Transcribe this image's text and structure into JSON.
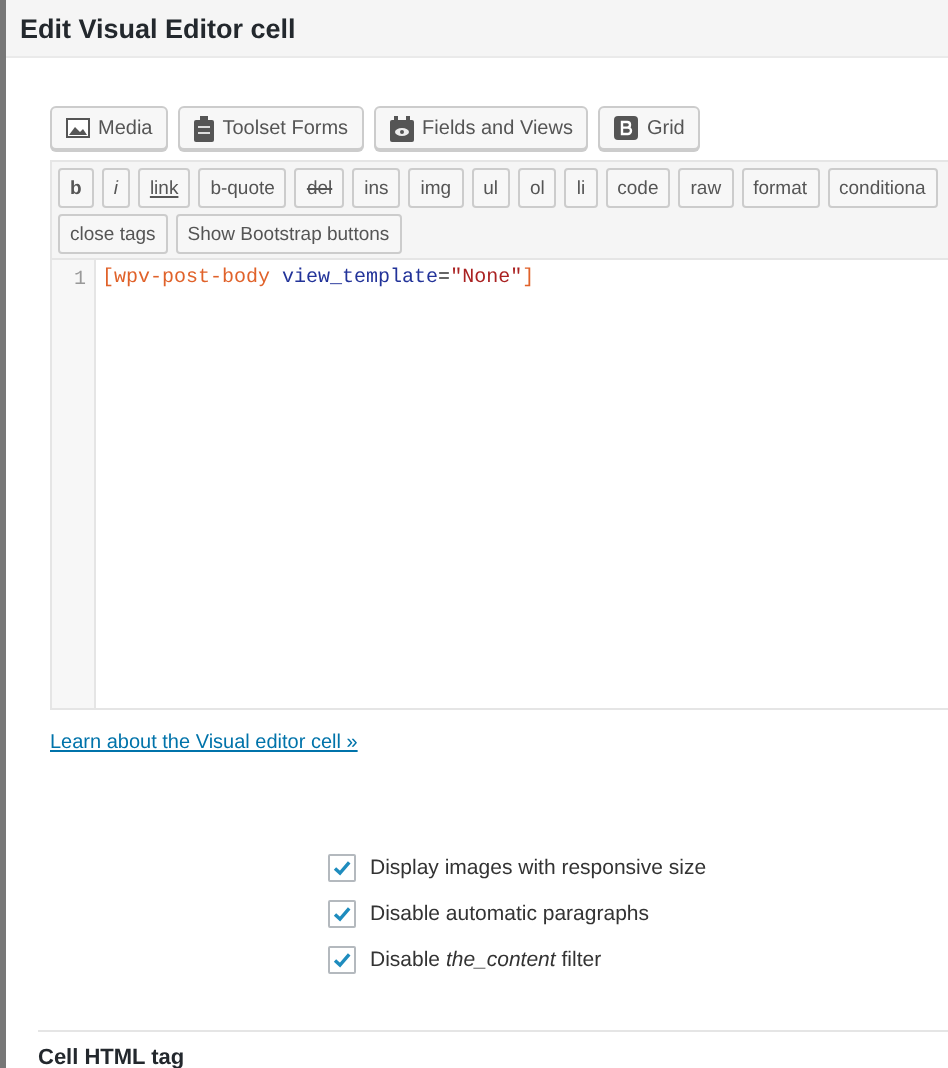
{
  "dialog": {
    "title": "Edit Visual Editor cell"
  },
  "media_buttons": [
    {
      "kind": "media",
      "label": "Media"
    },
    {
      "kind": "forms",
      "label": "Toolset Forms"
    },
    {
      "kind": "views",
      "label": "Fields and Views"
    },
    {
      "kind": "grid",
      "label": "Grid"
    }
  ],
  "quicktags": [
    {
      "label": "b",
      "kind": "bold"
    },
    {
      "label": "i",
      "kind": "italic"
    },
    {
      "label": "link",
      "kind": "underline"
    },
    {
      "label": "b-quote",
      "kind": "plain"
    },
    {
      "label": "del",
      "kind": "strike"
    },
    {
      "label": "ins",
      "kind": "plain"
    },
    {
      "label": "img",
      "kind": "plain"
    },
    {
      "label": "ul",
      "kind": "plain"
    },
    {
      "label": "ol",
      "kind": "plain"
    },
    {
      "label": "li",
      "kind": "plain"
    },
    {
      "label": "code",
      "kind": "plain"
    },
    {
      "label": "raw",
      "kind": "plain"
    },
    {
      "label": "format",
      "kind": "plain"
    },
    {
      "label": "conditiona",
      "kind": "plain"
    },
    {
      "label": "close tags",
      "kind": "plain"
    },
    {
      "label": "Show Bootstrap buttons",
      "kind": "plain"
    }
  ],
  "editor": {
    "lines": [
      {
        "number": "1",
        "tokens": [
          {
            "kind": "tag",
            "text": "[wpv-post-body"
          },
          {
            "kind": "attr",
            "text": "view_template"
          },
          {
            "kind": "plain",
            "text": "="
          },
          {
            "kind": "string",
            "text": "\"None\""
          },
          {
            "kind": "tag",
            "text": "]"
          }
        ]
      }
    ]
  },
  "help_link": "Learn about the Visual editor cell »",
  "options": [
    {
      "label": "Display images with responsive size",
      "checked": true
    },
    {
      "label": "Disable automatic paragraphs",
      "checked": true
    },
    {
      "label": "Disable *the_content* filter",
      "checked": true
    }
  ],
  "section_heading": "Cell HTML tag"
}
